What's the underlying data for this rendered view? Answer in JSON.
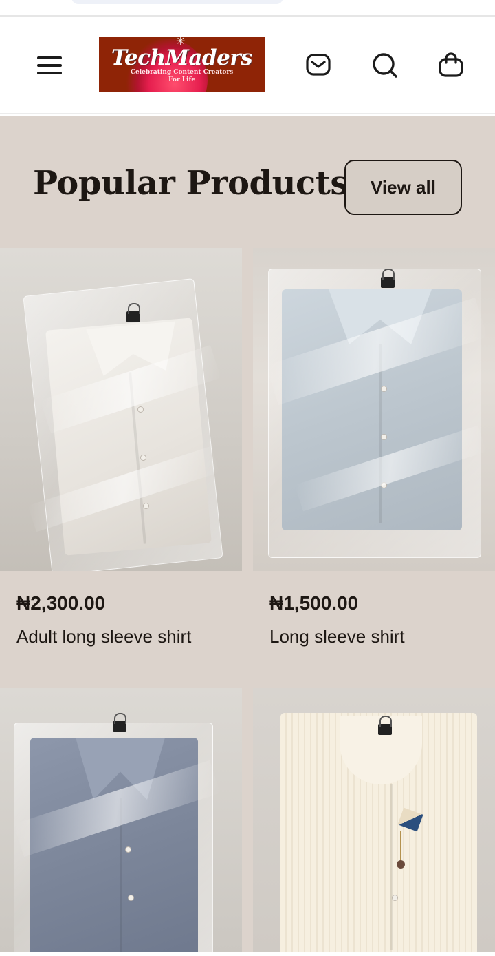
{
  "header": {
    "logo": {
      "brand": "TechMaders",
      "tagline_line1": "Celebrating Content Creators",
      "tagline_line2": "For Life"
    },
    "icons": [
      "menu-icon",
      "mail-icon",
      "search-icon",
      "shopping-bag-icon"
    ]
  },
  "section": {
    "title": "Popular Products",
    "view_all_label": "View all"
  },
  "products": [
    {
      "price": "₦2,300.00",
      "name": "Adult long sleeve shirt",
      "image": "white-shirt-in-plastic-bag"
    },
    {
      "price": "₦1,500.00",
      "name": "Long sleeve shirt",
      "image": "light-blue-shirt-in-plastic-bag"
    },
    {
      "price": "",
      "name": "",
      "image": "blue-shirt-in-plastic-bag"
    },
    {
      "price": "",
      "name": "",
      "image": "cream-striped-kaftan"
    }
  ],
  "colors": {
    "section_bg": "#dcd3cc",
    "text": "#1d1713",
    "logo_bg": "#8f2406",
    "logo_glow": "#e61f4f"
  }
}
